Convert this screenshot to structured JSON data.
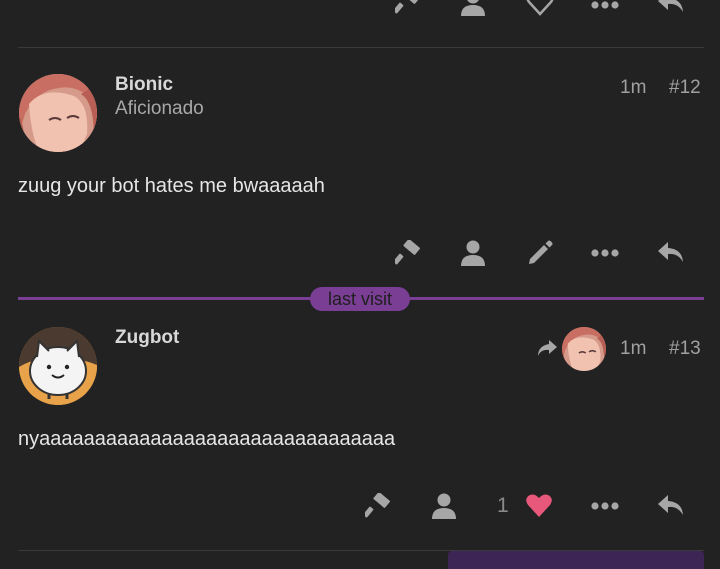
{
  "posts": [
    {
      "username": "Bionic",
      "title": "Aficionado",
      "time": "1m",
      "number": "#12",
      "body": "zuug your bot hates me bwaaaaah"
    },
    {
      "username": "Zugbot",
      "title": "",
      "time": "1m",
      "number": "#13",
      "body": "nyaaaaaaaaaaaaaaaaaaaaaaaaaaaaaaaa",
      "like_count": "1"
    }
  ],
  "separator": {
    "label": "last visit"
  },
  "colors": {
    "accent_purple": "#7a3f94",
    "like_heart": "#e8587a",
    "background": "#222223"
  },
  "icons": [
    "hammer-icon",
    "user-icon",
    "heart-icon",
    "more-icon",
    "reply-icon",
    "edit-icon",
    "reply-to-icon"
  ]
}
